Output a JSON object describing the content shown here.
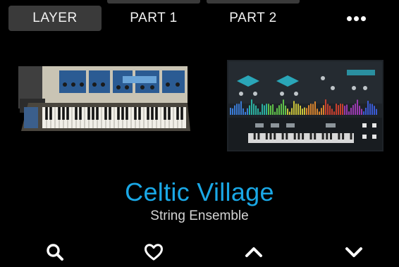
{
  "tabs": [
    {
      "label": "LAYER",
      "active": true
    },
    {
      "label": "PART 1",
      "active": false
    },
    {
      "label": "PART 2",
      "active": false
    }
  ],
  "more_icon": "ellipsis-icon",
  "preset": {
    "name": "Celtic Village",
    "category": "String Ensemble"
  },
  "instruments": [
    "vintage-synth-keyboard-image",
    "software-synth-plugin-image"
  ],
  "colors": {
    "accent": "#1aa8e6",
    "background": "#000000",
    "tab_active": "#3a3a3a"
  },
  "bottom_icons": [
    "search-icon",
    "heart-icon",
    "chevron-up-icon",
    "chevron-down-icon"
  ]
}
